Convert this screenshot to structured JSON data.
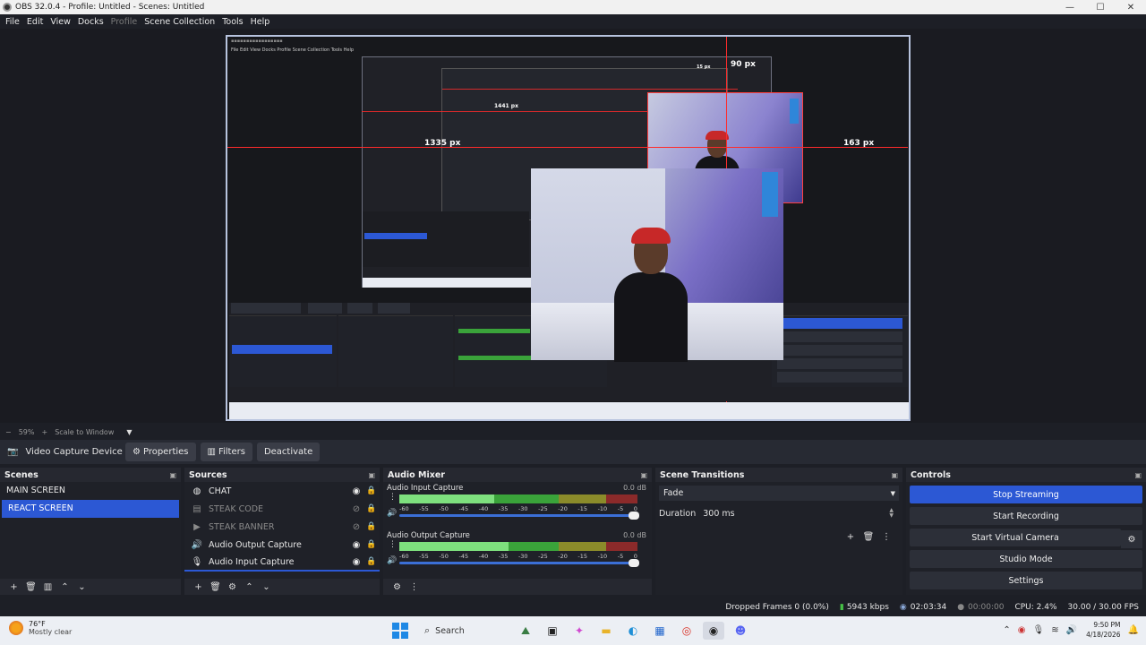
{
  "window": {
    "title": "OBS 32.0.4 - Profile: Untitled - Scenes: Untitled",
    "minimize_glyph": "—",
    "maximize_glyph": "☐",
    "close_glyph": "✕"
  },
  "menu": [
    "File",
    "Edit",
    "View",
    "Docks",
    "Profile",
    "Scene Collection",
    "Tools",
    "Help"
  ],
  "preview": {
    "measure_top": "90 px",
    "measure_left": "1335 px",
    "measure_right": "163 px",
    "measure_inner": "1441 px",
    "measure_inner_small": "15 px"
  },
  "zoom": {
    "minus": "−",
    "value": "59%",
    "plus": "+",
    "mode": "Scale to Window"
  },
  "context_bar": {
    "source_name": "Video Capture Device",
    "properties_label": "Properties",
    "filters_label": "Filters",
    "deactivate_label": "Deactivate"
  },
  "scenes": {
    "title": "Scenes",
    "items": [
      {
        "label": "MAIN SCREEN",
        "selected": false
      },
      {
        "label": "REACT SCREEN",
        "selected": true
      }
    ]
  },
  "sources": {
    "title": "Sources",
    "items": [
      {
        "label": "CHAT",
        "icon": "browser-icon",
        "visible": true
      },
      {
        "label": "STEAK CODE",
        "icon": "image-icon",
        "visible": false
      },
      {
        "label": "STEAK BANNER",
        "icon": "media-icon",
        "visible": false
      },
      {
        "label": "Audio Output Capture",
        "icon": "speaker-icon",
        "visible": true
      },
      {
        "label": "Audio Input Capture",
        "icon": "mic-icon",
        "visible": true
      }
    ]
  },
  "mixer": {
    "title": "Audio Mixer",
    "scale": [
      "-60",
      "-55",
      "-50",
      "-45",
      "-40",
      "-35",
      "-30",
      "-25",
      "-20",
      "-15",
      "-10",
      "-5",
      "0"
    ],
    "channels": [
      {
        "name": "Audio Input Capture",
        "db": "0.0 dB",
        "level": 0.55
      },
      {
        "name": "Audio Output Capture",
        "db": "0.0 dB",
        "level": 0.4
      }
    ]
  },
  "transitions": {
    "title": "Scene Transitions",
    "selected": "Fade",
    "duration_label": "Duration",
    "duration_value": "300 ms"
  },
  "controls": {
    "title": "Controls",
    "buttons": [
      "Stop Streaming",
      "Start Recording",
      "Start Virtual Camera",
      "Studio Mode",
      "Settings"
    ]
  },
  "status": {
    "dropped_frames": "Dropped Frames 0 (0.0%)",
    "bitrate": "5943 kbps",
    "stream_time": "02:03:34",
    "rec_time": "00:00:00",
    "cpu": "CPU: 2.4%",
    "fps": "30.00 / 30.00 FPS"
  },
  "taskbar": {
    "temperature": "76°F",
    "weather": "Mostly clear",
    "search_placeholder": "Search",
    "time": "9:50 PM",
    "date": "4/18/2026"
  },
  "colors": {
    "accent": "#2c58d4",
    "panel": "#1f2128",
    "meter_green": "#3aa33a",
    "guide_red": "#ff2b2b"
  }
}
